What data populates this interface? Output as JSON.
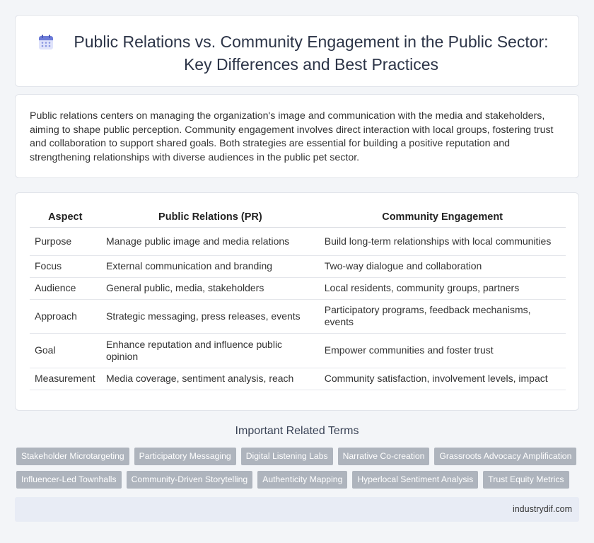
{
  "header": {
    "icon": "calendar-icon",
    "title": "Public Relations vs. Community Engagement in the Public Sector: Key Differences and Best Practices"
  },
  "intro": {
    "text": "Public relations centers on managing the organization's image and communication with the media and stakeholders, aiming to shape public perception. Community engagement involves direct interaction with local groups, fostering trust and collaboration to support shared goals. Both strategies are essential for building a positive reputation and strengthening relationships with diverse audiences in the public pet sector."
  },
  "table": {
    "headers": [
      "Aspect",
      "Public Relations (PR)",
      "Community Engagement"
    ],
    "rows": [
      [
        "Purpose",
        "Manage public image and media relations",
        "Build long-term relationships with local communities"
      ],
      [
        "Focus",
        "External communication and branding",
        "Two-way dialogue and collaboration"
      ],
      [
        "Audience",
        "General public, media, stakeholders",
        "Local residents, community groups, partners"
      ],
      [
        "Approach",
        "Strategic messaging, press releases, events",
        "Participatory programs, feedback mechanisms, events"
      ],
      [
        "Goal",
        "Enhance reputation and influence public opinion",
        "Empower communities and foster trust"
      ],
      [
        "Measurement",
        "Media coverage, sentiment analysis, reach",
        "Community satisfaction, involvement levels, impact"
      ]
    ]
  },
  "related": {
    "title": "Important Related Terms",
    "row1": [
      "Stakeholder Microtargeting",
      "Participatory Messaging",
      "Digital Listening Labs",
      "Narrative Co-creation",
      "Grassroots Advocacy Amplification"
    ],
    "row2": [
      "Influencer-Led Townhalls",
      "Community-Driven Storytelling",
      "Authenticity Mapping",
      "Hyperlocal Sentiment Analysis",
      "Trust Equity Metrics"
    ]
  },
  "footer": {
    "site": "industrydif.com"
  },
  "colors": {
    "tag_bg": "#aeb4bd",
    "footer_bg": "#e8ecf5",
    "title_color": "#2c3447"
  }
}
